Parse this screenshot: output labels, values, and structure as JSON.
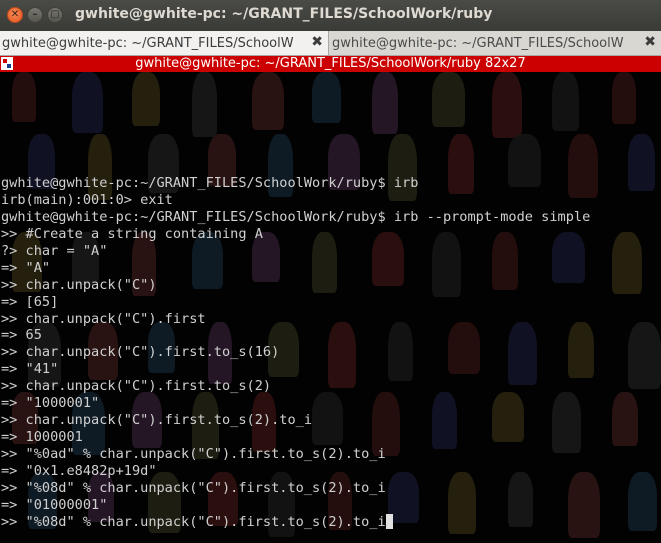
{
  "window": {
    "title": "gwhite@gwhite-pc: ~/GRANT_FILES/SchoolWork/ruby",
    "close_glyph": "✕",
    "minimize_glyph": "–",
    "maximize_glyph": "□"
  },
  "tabs": [
    {
      "label": "gwhite@gwhite-pc: ~/GRANT_FILES/SchoolW",
      "active": true,
      "close_glyph": "✖"
    },
    {
      "label": "gwhite@gwhite-pc: ~/GRANT_FILES/SchoolW",
      "active": false,
      "close_glyph": "✖"
    }
  ],
  "status_bar": {
    "text": "gwhite@gwhite-pc: ~/GRANT_FILES/SchoolWork/ruby 82x27",
    "icon": "terminal-app-icon",
    "color": "#cc0000"
  },
  "terminal": {
    "lines": [
      "gwhite@gwhite-pc:~/GRANT_FILES/SchoolWork/ruby$ irb",
      "irb(main):001:0> exit",
      "gwhite@gwhite-pc:~/GRANT_FILES/SchoolWork/ruby$ irb --prompt-mode simple",
      ">> #Create a string containing A",
      "?> char = \"A\"",
      "=> \"A\"",
      ">> char.unpack(\"C\")",
      "=> [65]",
      ">> char.unpack(\"C\").first",
      "=> 65",
      ">> char.unpack(\"C\").first.to_s(16)",
      "=> \"41\"",
      ">> char.unpack(\"C\").first.to_s(2)",
      "=> \"1000001\"",
      ">> char.unpack(\"C\").first.to_s(2).to_i",
      "=> 1000001",
      ">> \"%0ad\" % char.unpack(\"C\").first.to_s(2).to_i",
      "=> \"0x1.e8482p+19d\"",
      ">> \"%08d\" % char.unpack(\"C\").first.to_s(2).to_i",
      "=> \"01000001\"",
      ">> \"%08d\" % char.unpack(\"C\").first.to_s(2).to_i"
    ],
    "text_color": "#d0d0d0",
    "background_color": "#020202"
  }
}
